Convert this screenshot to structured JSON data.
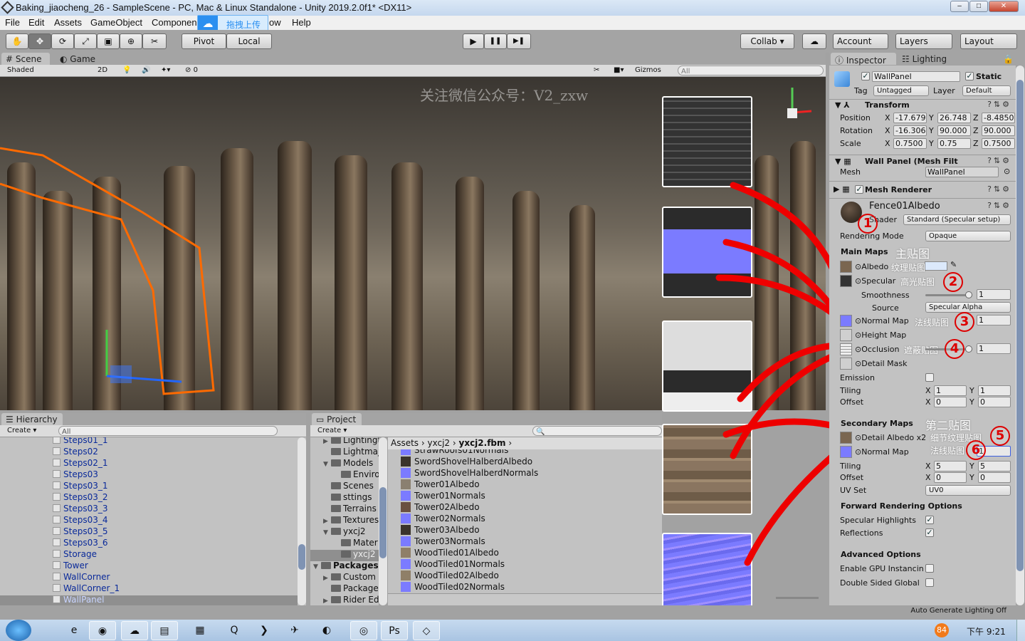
{
  "window": {
    "title": "Baking_jiaocheng_26 - SampleScene - PC, Mac & Linux Standalone - Unity 2019.2.0f1* <DX11>",
    "min": "–",
    "max": "□",
    "close": "✕"
  },
  "menu": [
    "File",
    "Edit",
    "Assets",
    "GameObject",
    "Componen",
    "ow",
    "Help"
  ],
  "upload_popup": {
    "icon": "cloud-icon",
    "label": "拖拽上传"
  },
  "toolbar": {
    "tools": [
      "✋",
      "✥",
      "⟳",
      "⤢",
      "▣",
      "⊕",
      "✂"
    ],
    "pivot": "Pivot",
    "local": "Local",
    "play": "▶",
    "pause": "❚❚",
    "step": "▶❚",
    "collab": "Collab ▾",
    "cloud": "☁",
    "account": "Account",
    "layers": "Layers",
    "layout": "Layout"
  },
  "scene_tabs": {
    "scene": "Scene",
    "game": "Game"
  },
  "scene_bar": {
    "shading": "Shaded",
    "mode2d": "2D",
    "fx_count": "0",
    "gizmos": "Gizmos",
    "search": "All"
  },
  "watermark": "关注微信公众号：V2_zxw",
  "inspector": {
    "tabs": {
      "inspector": "Inspector",
      "lighting": "Lighting"
    },
    "object_name": "WallPanel",
    "static_label": "Static",
    "tag_label": "Tag",
    "tag": "Untagged",
    "layer_label": "Layer",
    "layer": "Default",
    "transform": {
      "title": "Transform",
      "rows": [
        {
          "label": "Position",
          "x": "-17.679",
          "y": "26.748",
          "z": "-8.4850"
        },
        {
          "label": "Rotation",
          "x": "-16.306",
          "y": "90.000",
          "z": "90.000"
        },
        {
          "label": "Scale",
          "x": "0.7500",
          "y": "0.75",
          "z": "0.7500"
        }
      ]
    },
    "mesh_filter": {
      "title": "Wall Panel (Mesh Filt",
      "mesh_label": "Mesh",
      "mesh": "WallPanel"
    },
    "mesh_renderer": {
      "title": "Mesh Renderer"
    },
    "material": {
      "name": "Fence01Albedo",
      "shader_label": "Shader",
      "shader": "Standard (Specular setup)",
      "rendering_mode_label": "Rendering Mode",
      "rendering_mode": "Opaque",
      "main_maps": "Main Maps",
      "main_maps_cn": "主贴图",
      "albedo": "Albedo",
      "albedo_cn": "纹理贴图",
      "albedo_color": "#dce9fb",
      "specular": "Specular",
      "specular_cn": "高光贴图",
      "smoothness": "Smoothness",
      "smoothness_value": "1",
      "smoothness_level": 1.0,
      "source": "Source",
      "source_value": "Specular Alpha",
      "normal": "Normal Map",
      "normal_cn": "法线贴图",
      "normal_value": "1",
      "height": "Height Map",
      "occlusion": "Occlusion",
      "occlusion_cn": "遮蔽贴图",
      "occlusion_value": "1",
      "occlusion_level": 1.0,
      "detail_mask": "Detail Mask",
      "emission": "Emission",
      "tiling": "Tiling",
      "tiling_x": "1",
      "tiling_y": "1",
      "offset": "Offset",
      "offset_x": "0",
      "offset_y": "0",
      "secondary_maps": "Secondary Maps",
      "secondary_maps_cn": "第二贴图",
      "detail_albedo": "Detail Albedo x2",
      "detail_albedo_cn": "细节纹理贴图",
      "normal2": "Normal Map",
      "normal2_cn": "法线贴图",
      "normal2_value": "1",
      "tiling2_x": "5",
      "tiling2_y": "5",
      "offset2_x": "0",
      "offset2_y": "0",
      "uv_set": "UV Set",
      "uv_set_value": "UV0",
      "forward": "Forward Rendering Options",
      "spec_highlights": "Specular Highlights",
      "reflections": "Reflections",
      "advanced": "Advanced Options",
      "gpu": "Enable GPU Instancin",
      "double_sided": "Double Sided Global"
    },
    "annotations": [
      "1",
      "2",
      "3",
      "4",
      "5",
      "6"
    ],
    "x": "X",
    "y": "Y",
    "z": "Z"
  },
  "hierarchy": {
    "title": "Hierarchy",
    "create": "Create ▾",
    "search": "All",
    "items": [
      "Steps01_1",
      "Steps02",
      "Steps02_1",
      "Steps03",
      "Steps03_1",
      "Steps03_2",
      "Steps03_3",
      "Steps03_4",
      "Steps03_5",
      "Steps03_6",
      "Storage",
      "Tower",
      "WallCorner",
      "WallCorner_1",
      "WallPanel"
    ],
    "selected": "WallPanel"
  },
  "project": {
    "title": "Project",
    "create": "Create ▾",
    "tree": [
      {
        "label": "Lightingt",
        "indent": 1,
        "arrow": "▶"
      },
      {
        "label": "Lightmaj",
        "indent": 1,
        "arrow": ""
      },
      {
        "label": "Models",
        "indent": 1,
        "arrow": "▼"
      },
      {
        "label": "Enviro",
        "indent": 2,
        "arrow": ""
      },
      {
        "label": "Scenes",
        "indent": 1,
        "arrow": ""
      },
      {
        "label": "sttings",
        "indent": 1,
        "arrow": ""
      },
      {
        "label": "Terrains",
        "indent": 1,
        "arrow": ""
      },
      {
        "label": "Textures",
        "indent": 1,
        "arrow": "▶"
      },
      {
        "label": "yxcj2",
        "indent": 1,
        "arrow": "▼"
      },
      {
        "label": "Mater",
        "indent": 2,
        "arrow": ""
      },
      {
        "label": "yxcj2",
        "indent": 2,
        "arrow": "",
        "selected": true
      },
      {
        "label": "Packages",
        "indent": 0,
        "arrow": "▼",
        "bold": true
      },
      {
        "label": "Custom",
        "indent": 1,
        "arrow": "▶"
      },
      {
        "label": "Package",
        "indent": 1,
        "arrow": ""
      },
      {
        "label": "Rider Ed",
        "indent": 1,
        "arrow": "▶"
      }
    ],
    "breadcrumb": [
      "Assets",
      "yxcj2",
      "yxcj2.fbm"
    ],
    "assets": [
      {
        "name": "StrawRoofs01Normals",
        "kind": "normal"
      },
      {
        "name": "SwordShovelHalberdAlbedo",
        "kind": "dark"
      },
      {
        "name": "SwordShovelHalberdNormals",
        "kind": "normal"
      },
      {
        "name": "Tower01Albedo",
        "kind": "stone"
      },
      {
        "name": "Tower01Normals",
        "kind": "normal"
      },
      {
        "name": "Tower02Albedo",
        "kind": "brick"
      },
      {
        "name": "Tower02Normals",
        "kind": "normal"
      },
      {
        "name": "Tower03Albedo",
        "kind": "dark"
      },
      {
        "name": "Tower03Normals",
        "kind": "normal"
      },
      {
        "name": "WoodTiled01Albedo",
        "kind": "wood"
      },
      {
        "name": "WoodTiled01Normals",
        "kind": "normal"
      },
      {
        "name": "WoodTiled02Albedo",
        "kind": "wood"
      },
      {
        "name": "WoodTiled02Normals",
        "kind": "normal"
      }
    ]
  },
  "status": {
    "text": "Auto Generate Lighting Off"
  },
  "taskbar": {
    "apps": [
      "windows-start",
      "ie",
      "chrome",
      "baidu-netdisk",
      "explorer",
      "winrar",
      "iqiyi",
      "app-green",
      "feishu",
      "browser",
      "app-circle",
      "photoshop",
      "unity"
    ],
    "tray_badge": "84",
    "clock": "下午 9:21"
  },
  "colors": {
    "normal_map": "#7b7bff",
    "annotation": "#dd0000",
    "selection_outline": "#ff6a00"
  }
}
